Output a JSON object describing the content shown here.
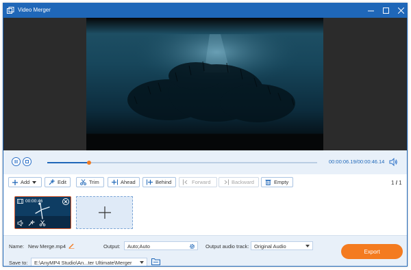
{
  "window": {
    "title": "Video Merger"
  },
  "player": {
    "current_time": "00:00:06.19",
    "total_time": "00:00:46.14",
    "time_separator": "/",
    "progress": 0.155
  },
  "toolbar": {
    "add": "Add",
    "edit": "Edit",
    "trim": "Trim",
    "ahead": "Ahead",
    "behind": "Behind",
    "forward": "Forward",
    "backward": "Backward",
    "empty": "Empty"
  },
  "pager": {
    "current": "1",
    "separator": "/",
    "total": "1"
  },
  "clip": {
    "duration": "00:00:46"
  },
  "settings": {
    "name_label": "Name:",
    "name_value": "New Merge.mp4",
    "output_label": "Output:",
    "output_value": "Auto;Auto",
    "audio_label": "Output audio track:",
    "audio_value": "Original Audio",
    "save_label": "Save to:",
    "save_value": "E:\\AnyMP4 Studio\\An...ter Ultimate\\Merger",
    "export": "Export"
  },
  "colors": {
    "accent": "#1f67b8",
    "export": "#f47b20",
    "progress_knob": "#f07a22"
  }
}
